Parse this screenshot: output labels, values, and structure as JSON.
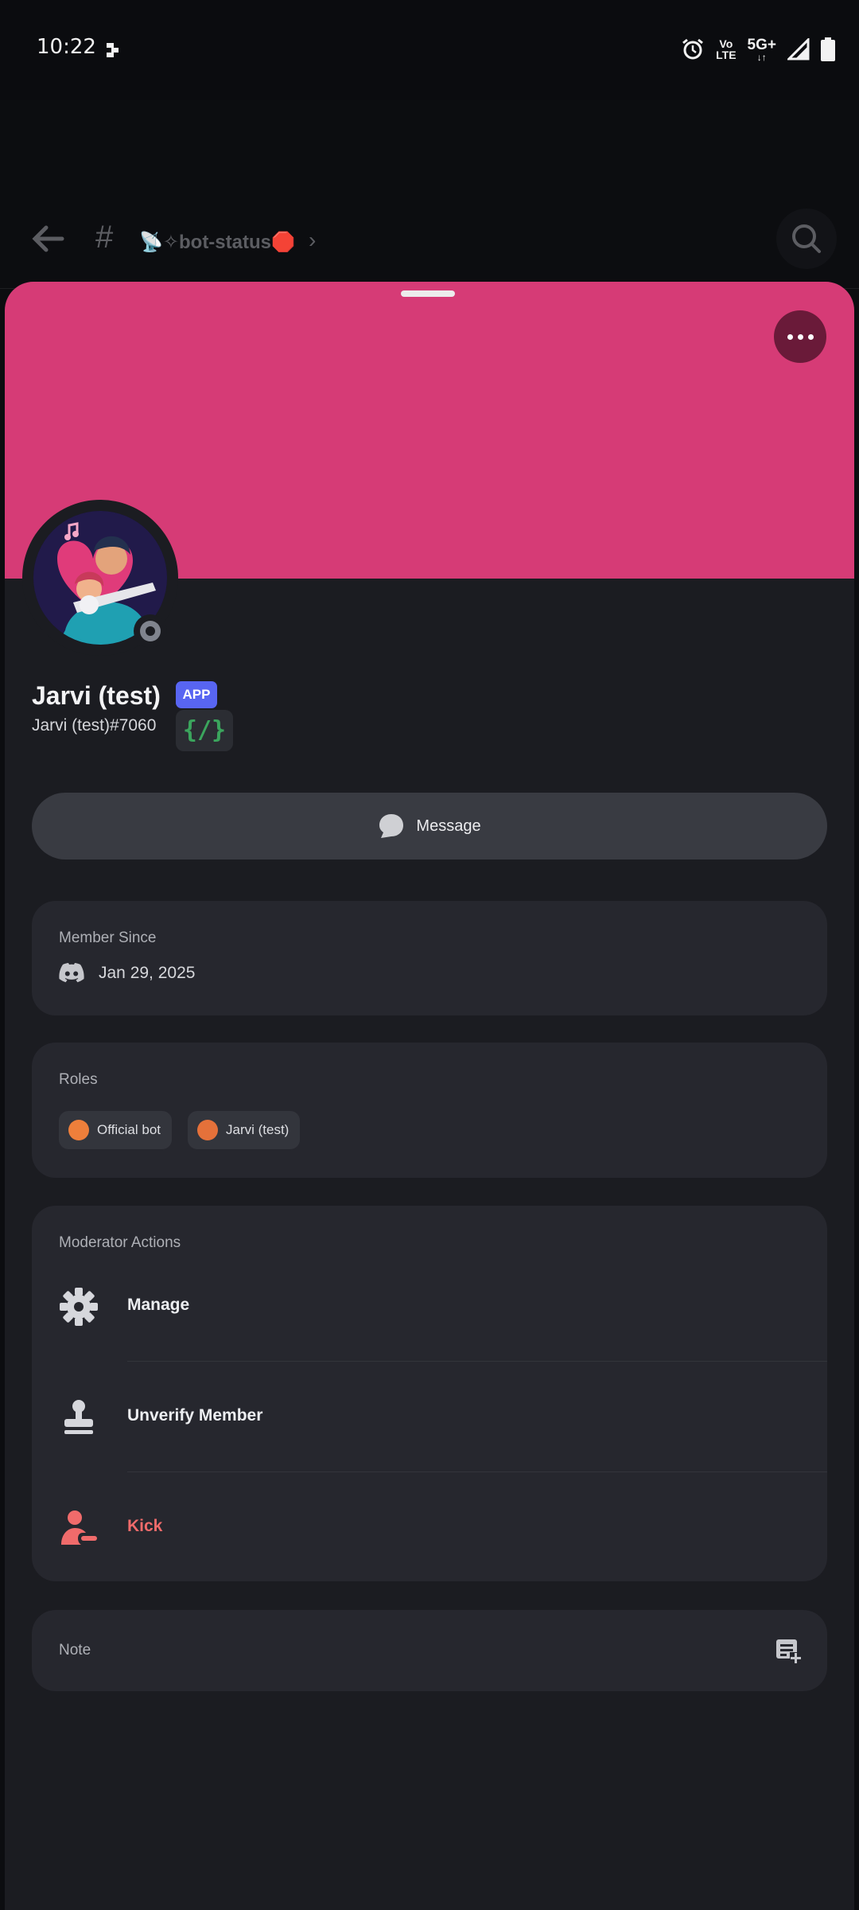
{
  "status_bar": {
    "time": "10:22",
    "volte_top": "Vo",
    "volte_bottom": "LTE",
    "network": "5G+",
    "icons": [
      "notification-icon",
      "alarm-icon",
      "volte-icon",
      "signal-icon",
      "battery-icon"
    ]
  },
  "background_channel": {
    "channel_name": "📡✧bot-status🛑"
  },
  "profile": {
    "banner_color": "#d63b76",
    "display_name": "Jarvi (test)",
    "badge": "APP",
    "username": "Jarvi (test)#7060",
    "commands_badge": "{/}",
    "status": "offline"
  },
  "message_button": {
    "label": "Message"
  },
  "member_since": {
    "title": "Member Since",
    "date": "Jan 29, 2025"
  },
  "roles": {
    "title": "Roles",
    "items": [
      {
        "label": "Official bot",
        "color": "#ee7f3b"
      },
      {
        "label": "Jarvi (test)",
        "color": "#e5713a"
      }
    ]
  },
  "moderator_actions": {
    "title": "Moderator Actions",
    "items": [
      {
        "label": "Manage",
        "icon": "gear-icon"
      },
      {
        "label": "Unverify Member",
        "icon": "stamp-icon"
      },
      {
        "label": "Kick",
        "icon": "kick-user-icon",
        "color": "#f06b6b"
      }
    ]
  },
  "note": {
    "label": "Note"
  }
}
